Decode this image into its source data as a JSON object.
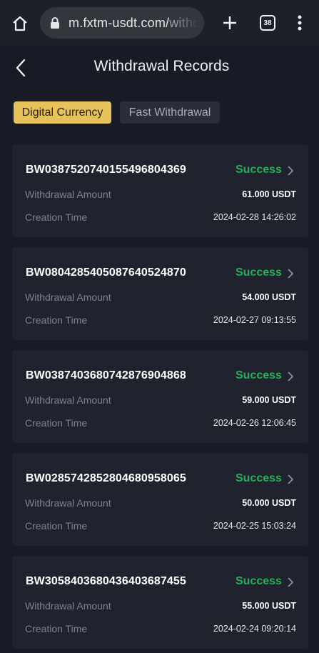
{
  "browser": {
    "url_main": "m.fxtm-usdt.com/",
    "url_rest": "withd",
    "tab_count": "38",
    "icons": [
      "home-icon",
      "lock-icon",
      "plus-icon",
      "tabs-icon",
      "more-vert-icon"
    ]
  },
  "header": {
    "title": "Withdrawal Records",
    "back_icon": "chevron-left-icon"
  },
  "tabs": [
    {
      "label": "Digital Currency",
      "active": true
    },
    {
      "label": "Fast Withdrawal",
      "active": false
    }
  ],
  "labels": {
    "amount": "Withdrawal Amount",
    "time": "Creation Time"
  },
  "records": [
    {
      "id": "BW038752074015549680436​9",
      "status": "Success",
      "amount": "61.000 USDT",
      "time": "2024-02-28 14:26:02"
    },
    {
      "id": "BW080428540508764052487​0",
      "status": "Success",
      "amount": "54.000 USDT",
      "time": "2024-02-27 09:13:55"
    },
    {
      "id": "BW038740368074287690486​8",
      "status": "Success",
      "amount": "59.000 USDT",
      "time": "2024-02-26 12:06:45"
    },
    {
      "id": "BW028574285280468095806​5",
      "status": "Success",
      "amount": "50.000 USDT",
      "time": "2024-02-25 15:03:24"
    },
    {
      "id": "BW305840368043640368745​5",
      "status": "Success",
      "amount": "55.000 USDT",
      "time": "2024-02-24 09:20:14"
    }
  ],
  "colors": {
    "accent": "#e7c15a",
    "success": "#22b155",
    "background": "#181b25",
    "card": "#20232d"
  }
}
